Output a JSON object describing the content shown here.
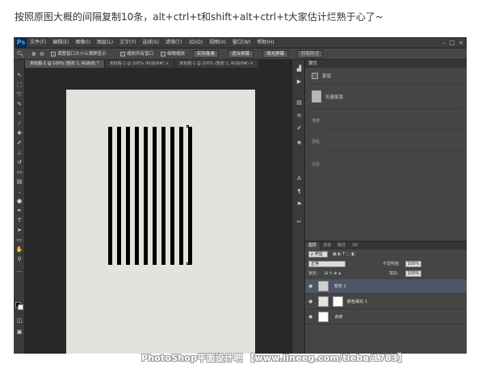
{
  "caption": "按照原图大概的间隔复制10条，alt+ctrl+t和shift+alt+ctrl+t大家估计烂熟于心了~",
  "app": {
    "logo": "Ps",
    "menu": [
      "文件(F)",
      "编辑(E)",
      "图像(I)",
      "图层(L)",
      "文字(Y)",
      "选择(S)",
      "滤镜(T)",
      "3D(D)",
      "视图(V)",
      "窗口(W)",
      "帮助(H)"
    ],
    "window_controls": [
      "–",
      "□",
      "×"
    ]
  },
  "options_bar": {
    "check_resize": "调整窗口大小以满屏显示",
    "check_zoom_all": "缩放所有窗口",
    "check_scrubby": "细微缩放",
    "btn_actual": "实际像素",
    "btn_fit": "适合屏幕",
    "btn_fill": "填充屏幕",
    "btn_print": "打印尺寸"
  },
  "tabs": [
    {
      "label": "未标题-2 @ 100% (矩形 1, RGB/8) *",
      "active": true
    },
    {
      "label": "未标题-1 @ 100% (RGB/8#) ×",
      "active": false
    },
    {
      "label": "未标题-1 @ 200% (矩形 1, RGB/8#) ×",
      "active": false
    }
  ],
  "properties_panel": {
    "title": "属性",
    "mask_label": "蒙版",
    "vector_mask": "矢量蒙版",
    "density_label": "浓度:",
    "feather_label": "羽化:",
    "adjust_label": "调整:"
  },
  "layers_panel": {
    "tabs": [
      "图层",
      "通道",
      "路径",
      "3D"
    ],
    "filter_label": "ρ 类型",
    "blend_mode": "正常",
    "opacity_label": "不透明度:",
    "opacity_value": "100%",
    "lock_label": "锁定:",
    "fill_label": "填充:",
    "fill_value": "100%",
    "layers": [
      {
        "name": "矩形 1",
        "selected": true,
        "thumb_color": "#cfcfcf"
      },
      {
        "name": "颜色填充 1",
        "selected": false,
        "thumb_color": "#e2e3dc"
      },
      {
        "name": "背景",
        "selected": false,
        "thumb_color": "#ffffff"
      }
    ]
  },
  "document": {
    "canvas_color": "#e2e3dc",
    "stripe_color": "#000000",
    "stripe_count": 10
  },
  "watermark": "PhotoShop平面设计吧 【www.lineeg.com/tieba/1783】"
}
